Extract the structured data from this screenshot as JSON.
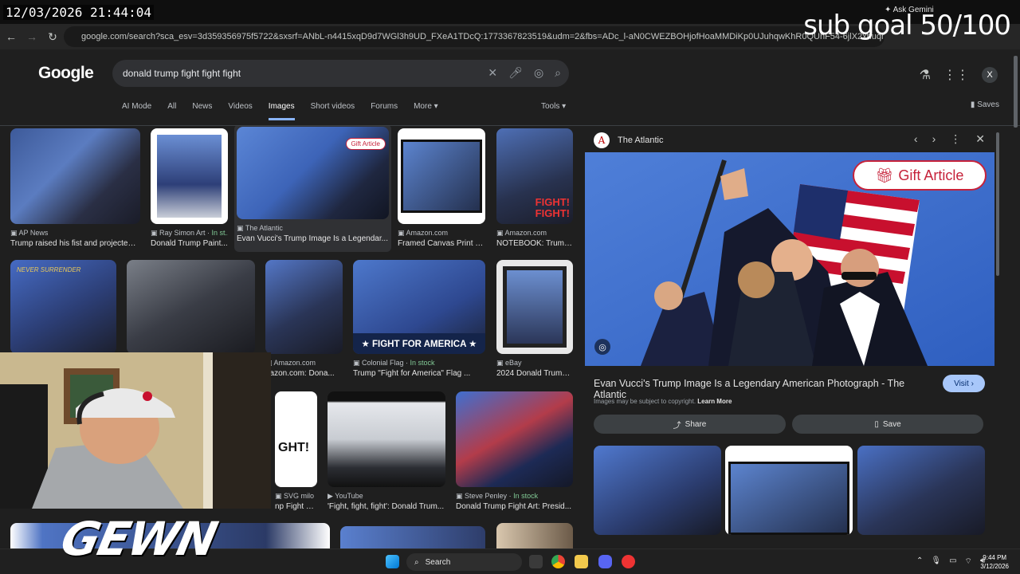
{
  "overlay": {
    "timestamp": "12/03/2026 21:44:04",
    "sub_counter": "sub goal 50/100",
    "watermark": "GEWN"
  },
  "browser": {
    "url": "google.com/search?sca_esv=3d359356975f5722&sxsrf=ANbL-n4415xqD9d7WGl3h9UD_FXeA1TDcQ:1773367823519&udm=2&fbs=ADc_l-aN0CWEZBOHjofHoaMMDiKp0UJuhqwKhR0QUhF54-6jlX2xhuqmjuyJb8bmeAomnwitj...",
    "ask_gemini": "Ask Gemini"
  },
  "google": {
    "logo": "Google",
    "query": "donald trump fight fight fight",
    "tabs": [
      "AI Mode",
      "All",
      "News",
      "Videos",
      "Images",
      "Short videos",
      "Forums",
      "More ▾"
    ],
    "active_tab": "Images",
    "tools": "Tools ▾",
    "saves": "Saves",
    "avatar_letter": "X"
  },
  "results": [
    {
      "source": "AP News",
      "caption": "Trump raised his fist and projected ..."
    },
    {
      "source": "Ray Simon Art",
      "stock": "In st...",
      "caption": "Donald Trump Paint..."
    },
    {
      "source": "The Atlantic",
      "caption": "Evan Vucci's Trump Image Is a Legendar...",
      "badge": "Gift Article"
    },
    {
      "source": "Amazon.com",
      "caption": "Framed Canvas Print w..."
    },
    {
      "source": "Amazon.com",
      "caption": "NOTEBOOK: Trump ..."
    },
    {
      "source": "Amazon.com",
      "caption": "nazon.com: Dona..."
    },
    {
      "source": "Colonial Flag",
      "stock": "In stock",
      "caption": "Trump \"Fight for America\" Flag ...",
      "banner": "★ FIGHT FOR AMERICA ★"
    },
    {
      "source": "eBay",
      "caption": "2024 Donald Trump..."
    },
    {
      "source": "SVG milo",
      "caption": "np Fight Fi..."
    },
    {
      "source": "YouTube",
      "caption": "'Fight, fight, fight': Donald Trum..."
    },
    {
      "source": "Steve Penley",
      "stock": "In stock",
      "caption": "Donald Trump Fight Art: Presid..."
    }
  ],
  "thumb_text": {
    "never_surrender": "NEVER SURRENDER",
    "fight": "FIGHT!",
    "ght": "GHT!"
  },
  "panel": {
    "site": "The Atlantic",
    "gift": "Gift Article",
    "title": "Evan Vucci's Trump Image Is a Legendary American Photograph - The Atlantic",
    "visit": "Visit ›",
    "copyright": "Images may be subject to copyright.",
    "learn_more": "Learn More",
    "share": "Share",
    "save": "Save"
  },
  "taskbar": {
    "search": "Search",
    "time": "9:44 PM",
    "date": "3/12/2026"
  },
  "colors": {
    "accent": "#8ab4f8",
    "visit_bg": "#a8c7fa",
    "atlantic_red": "#c6223a",
    "stock_green": "#81c995"
  }
}
